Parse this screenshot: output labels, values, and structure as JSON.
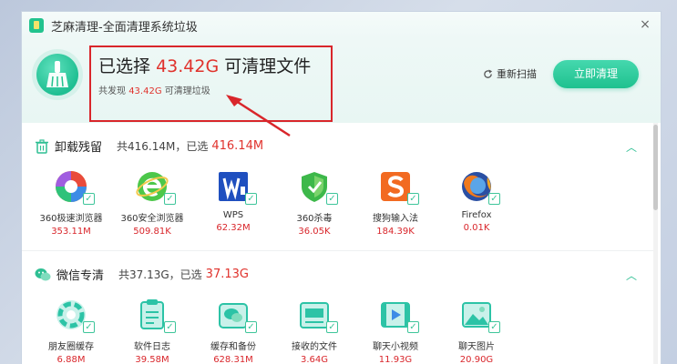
{
  "window": {
    "title": "芝麻清理-全面清理系统垃圾",
    "close_glyph": "×"
  },
  "header": {
    "headline_prefix": "已选择",
    "headline_value": "43.42G",
    "headline_suffix": "可清理文件",
    "sub_prefix": "共发现",
    "sub_value": "43.42G",
    "sub_suffix": "可清理垃圾",
    "rescan_label": "重新扫描",
    "clean_label": "立即清理"
  },
  "sections": [
    {
      "name": "卸载残留",
      "total": "共416.14M，已选",
      "selected": "416.14M",
      "icon": "trash-icon",
      "items": [
        {
          "name": "360极速浏览器",
          "size": "353.11M",
          "icon": "360-speed-browser-icon"
        },
        {
          "name": "360安全浏览器",
          "size": "509.81K",
          "icon": "360-safe-browser-icon"
        },
        {
          "name": "WPS",
          "size": "62.32M",
          "icon": "wps-icon"
        },
        {
          "name": "360杀毒",
          "size": "36.05K",
          "icon": "360-antivirus-icon"
        },
        {
          "name": "搜狗输入法",
          "size": "184.39K",
          "icon": "sogou-input-icon"
        },
        {
          "name": "Firefox",
          "size": "0.01K",
          "icon": "firefox-icon"
        }
      ]
    },
    {
      "name": "微信专清",
      "total": "共37.13G，已选",
      "selected": "37.13G",
      "icon": "wechat-icon",
      "items": [
        {
          "name": "朋友圈缓存",
          "size": "6.88M",
          "icon": "moments-icon"
        },
        {
          "name": "软件日志",
          "size": "39.58M",
          "icon": "log-icon"
        },
        {
          "name": "缓存和备份",
          "size": "628.31M",
          "icon": "cache-backup-icon"
        },
        {
          "name": "接收的文件",
          "size": "3.64G",
          "icon": "received-files-icon"
        },
        {
          "name": "聊天小视频",
          "size": "11.93G",
          "icon": "chat-video-icon"
        },
        {
          "name": "聊天图片",
          "size": "20.90G",
          "icon": "chat-image-icon"
        }
      ]
    }
  ],
  "check_glyph": "✓",
  "colors": {
    "accent": "#1fc18f",
    "highlight_red": "#d9262b",
    "value_red": "#e0322c"
  }
}
